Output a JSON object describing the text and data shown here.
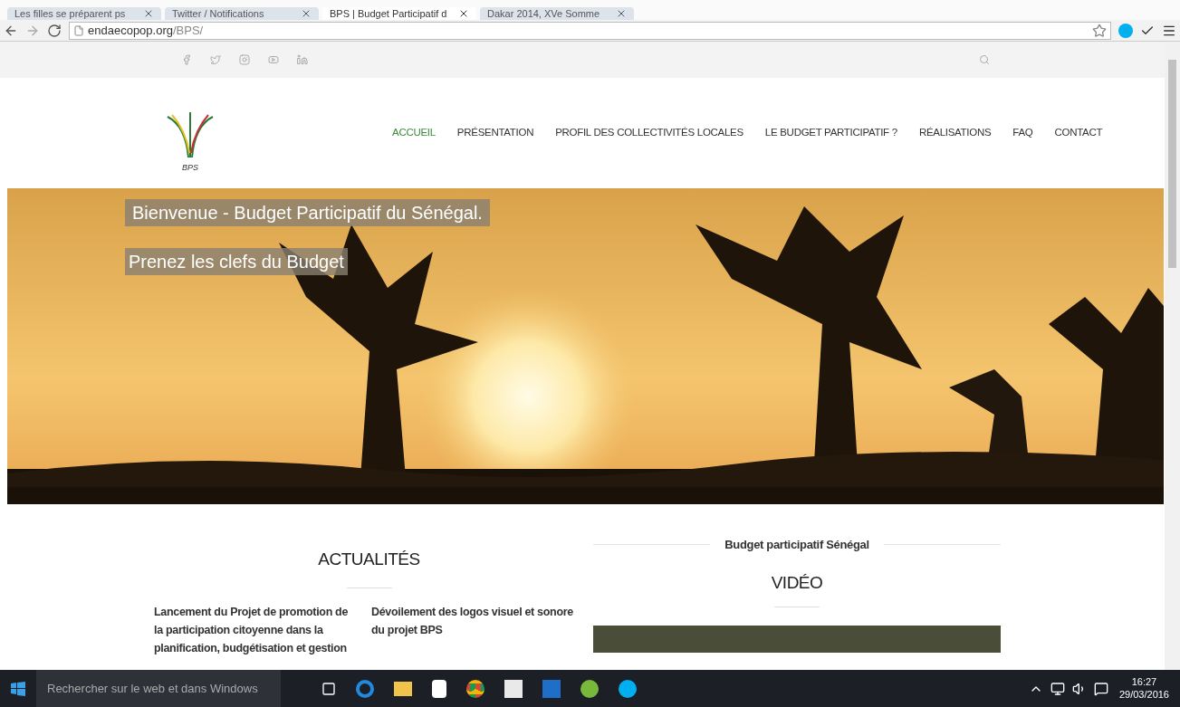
{
  "browser": {
    "tabs": [
      {
        "title": "Les filles se préparent ps",
        "selected": false
      },
      {
        "title": "Twitter / Notifications",
        "selected": false
      },
      {
        "title": "BPS | Budget Participatif d",
        "selected": true
      },
      {
        "title": "Dakar 2014, XVe Somme",
        "selected": false
      }
    ],
    "url_host": "endaecopop.org",
    "url_path": "/BPS/"
  },
  "social_bar": {
    "icons": [
      {
        "kind": "facebook"
      },
      {
        "kind": "twitter"
      },
      {
        "kind": "instagram"
      },
      {
        "kind": "youtube"
      },
      {
        "kind": "linkedin"
      }
    ]
  },
  "header": {
    "logo_text": "BPS",
    "nav": [
      {
        "label": "ACCUEIL",
        "selected": true
      },
      {
        "label": "PRÉSENTATION",
        "selected": false
      },
      {
        "label": "PROFIL DES COLLECTIVITÉS LOCALES",
        "selected": false
      },
      {
        "label": "LE BUDGET PARTICIPATIF ?",
        "selected": false
      },
      {
        "label": "RÉALISATIONS",
        "selected": false
      },
      {
        "label": "FAQ",
        "selected": false
      },
      {
        "label": "CONTACT",
        "selected": false
      }
    ]
  },
  "hero": {
    "kind": "picture",
    "title": "Bienvenue - Budget Participatif du Sénégal.",
    "subtitle": "Prenez les clefs du Budget"
  },
  "news": {
    "heading": "ACTUALITÉS",
    "items": [
      "Lancement du Projet de promotion de la participation citoyenne dans la planification, budgétisation et gestion",
      "Dévoilement des logos visuel et sonore du projet BPS"
    ]
  },
  "video": {
    "kicker": "Budget participatif Sénégal",
    "heading": "VIDÉO"
  },
  "taskbar": {
    "search": "Rechercher sur le web et dans Windows",
    "time": "16:27",
    "date": "29/03/2016"
  }
}
